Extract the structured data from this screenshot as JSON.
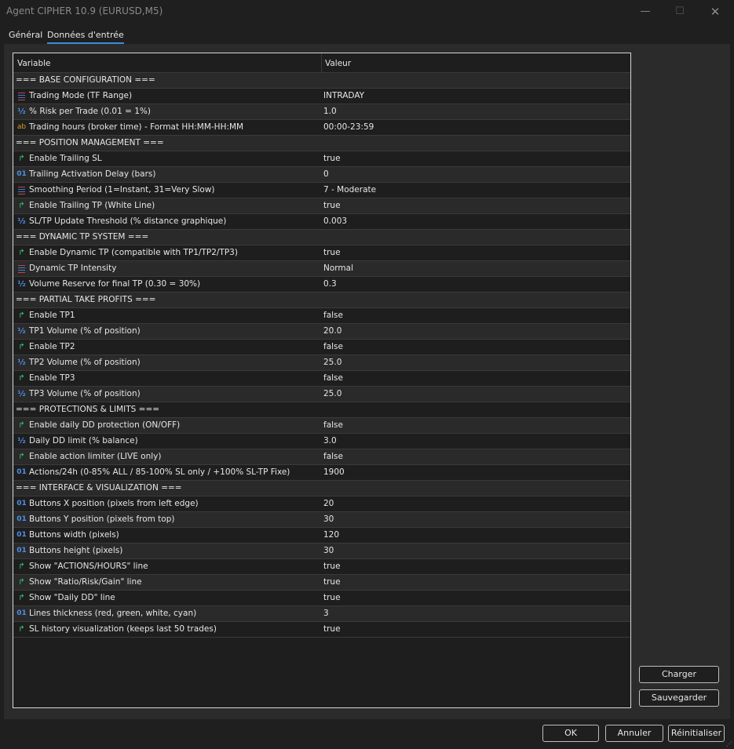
{
  "window": {
    "title": "Agent CIPHER 10.9 (EURUSD,M5)"
  },
  "tabs": [
    {
      "label": "Général",
      "active": false
    },
    {
      "label": "Données d'entrée",
      "active": true
    }
  ],
  "grid": {
    "col_variable": "Variable",
    "col_value": "Valeur",
    "rows": [
      {
        "type": "section",
        "variable": "=== BASE CONFIGURATION ===",
        "value": ""
      },
      {
        "type": "enum",
        "variable": "Trading Mode (TF Range)",
        "value": "INTRADAY"
      },
      {
        "type": "double",
        "variable": "% Risk per Trade (0.01 = 1%)",
        "value": "1.0"
      },
      {
        "type": "string",
        "variable": "Trading hours (broker time) - Format HH:MM-HH:MM",
        "value": "00:00-23:59"
      },
      {
        "type": "section",
        "variable": "===  POSITION MANAGEMENT ===",
        "value": ""
      },
      {
        "type": "bool",
        "variable": "Enable Trailing SL",
        "value": "true"
      },
      {
        "type": "int",
        "variable": "Trailing Activation Delay (bars)",
        "value": "0"
      },
      {
        "type": "enum",
        "variable": "Smoothing Period (1=Instant, 31=Very Slow)",
        "value": "7 - Moderate"
      },
      {
        "type": "bool",
        "variable": "Enable Trailing TP (White Line)",
        "value": "true"
      },
      {
        "type": "double",
        "variable": "SL/TP Update Threshold (% distance graphique)",
        "value": "0.003"
      },
      {
        "type": "section",
        "variable": "=== DYNAMIC TP SYSTEM ===",
        "value": ""
      },
      {
        "type": "bool",
        "variable": "Enable Dynamic TP (compatible with TP1/TP2/TP3)",
        "value": "true"
      },
      {
        "type": "enum",
        "variable": "Dynamic TP Intensity",
        "value": "Normal"
      },
      {
        "type": "double",
        "variable": "Volume Reserve for final TP (0.30 = 30%)",
        "value": "0.3"
      },
      {
        "type": "section",
        "variable": "=== PARTIAL TAKE PROFITS ===",
        "value": ""
      },
      {
        "type": "bool",
        "variable": "Enable TP1",
        "value": "false"
      },
      {
        "type": "double",
        "variable": "TP1 Volume (% of position)",
        "value": "20.0"
      },
      {
        "type": "bool",
        "variable": "Enable TP2",
        "value": "false"
      },
      {
        "type": "double",
        "variable": "TP2 Volume (% of position)",
        "value": "25.0"
      },
      {
        "type": "bool",
        "variable": "Enable TP3",
        "value": "false"
      },
      {
        "type": "double",
        "variable": "TP3 Volume (% of position)",
        "value": "25.0"
      },
      {
        "type": "section",
        "variable": "=== PROTECTIONS & LIMITS ===",
        "value": ""
      },
      {
        "type": "bool",
        "variable": "Enable daily DD protection (ON/OFF)",
        "value": "false"
      },
      {
        "type": "double",
        "variable": "Daily DD limit (% balance)",
        "value": "3.0"
      },
      {
        "type": "bool",
        "variable": "Enable action limiter (LIVE only)",
        "value": "false"
      },
      {
        "type": "int",
        "variable": "Actions/24h (0-85% ALL / 85-100% SL only / +100% SL-TP Fixe)",
        "value": "1900"
      },
      {
        "type": "section",
        "variable": "=== INTERFACE & VISUALIZATION ===",
        "value": ""
      },
      {
        "type": "int",
        "variable": "Buttons X position (pixels from left edge)",
        "value": "20"
      },
      {
        "type": "int",
        "variable": "Buttons Y position (pixels from top)",
        "value": "30"
      },
      {
        "type": "int",
        "variable": "Buttons width (pixels)",
        "value": "120"
      },
      {
        "type": "int",
        "variable": "Buttons height (pixels)",
        "value": "30"
      },
      {
        "type": "bool",
        "variable": "Show \"ACTIONS/HOURS\" line",
        "value": "true"
      },
      {
        "type": "bool",
        "variable": "Show \"Ratio/Risk/Gain\" line",
        "value": "true"
      },
      {
        "type": "bool",
        "variable": "Show \"Daily DD\" line",
        "value": "true"
      },
      {
        "type": "int",
        "variable": "Lines thickness (red, green, white, cyan)",
        "value": "3"
      },
      {
        "type": "bool",
        "variable": "SL history visualization (keeps last 50 trades)",
        "value": "true"
      }
    ]
  },
  "side_buttons": {
    "load": "Charger",
    "save": "Sauvegarder"
  },
  "footer": {
    "ok": "OK",
    "cancel": "Annuler",
    "reset": "Réinitialiser"
  },
  "icons": {
    "enum": "list-enum-icon",
    "double": "half-fraction-icon",
    "string": "ab-string-icon",
    "bool": "toggle-arrow-icon",
    "int": "01-integer-icon"
  }
}
